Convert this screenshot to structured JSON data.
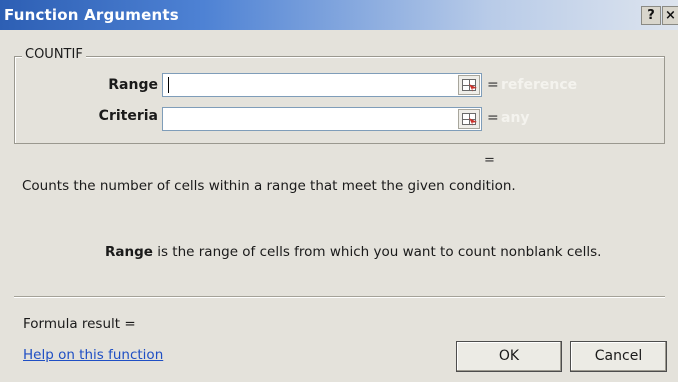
{
  "window": {
    "title": "Function Arguments",
    "help_button": "?",
    "close_button": "×"
  },
  "function": {
    "name": "COUNTIF",
    "args": [
      {
        "label": "Range",
        "value": "",
        "eq": "=",
        "hint": "reference"
      },
      {
        "label": "Criteria",
        "value": "",
        "eq": "=",
        "hint": "any"
      }
    ]
  },
  "result_eq": "=",
  "description": "Counts the number of cells within a range that meet the given condition.",
  "arg_help": {
    "name": "Range",
    "text": " is the range of cells from which you want to count nonblank cells."
  },
  "formula_result_label": "Formula result =",
  "help_link": "Help on this function",
  "buttons": {
    "ok": "OK",
    "cancel": "Cancel"
  },
  "icons": {
    "help": "question-mark-icon",
    "close": "close-icon",
    "ref_select": "collapse-dialog-range-icon"
  },
  "colors": {
    "title_gradient_start": "#2d5fb4",
    "dialog_bg": "#e4e2db",
    "link": "#1f4fc4",
    "hint_text": "#f4f3ee"
  }
}
